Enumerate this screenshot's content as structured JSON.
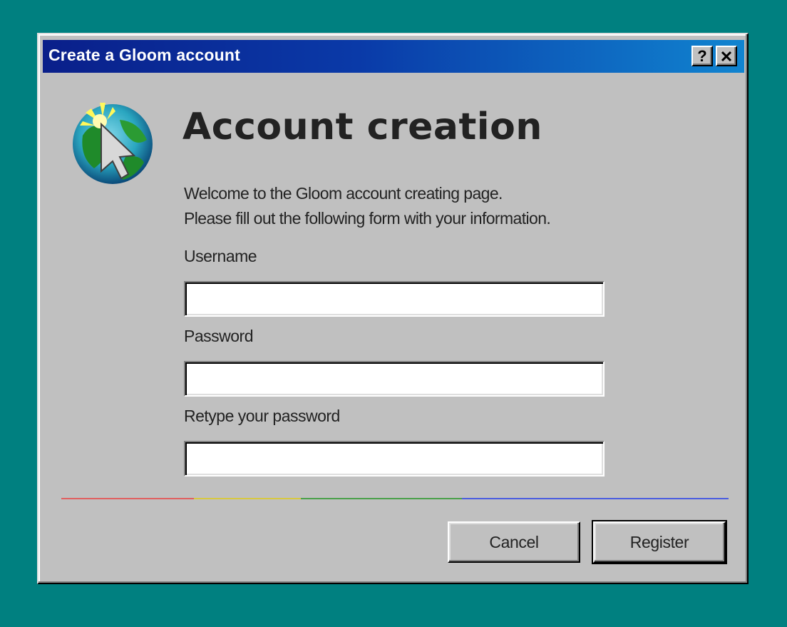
{
  "window": {
    "title": "Create a Gloom account",
    "help_label": "?",
    "close_label": "×"
  },
  "content": {
    "heading": "Account creation",
    "intro_line1": "Welcome to the Gloom account creating page.",
    "intro_line2": "Please fill out the following form with your information."
  },
  "form": {
    "username_label": "Username",
    "username_value": "",
    "password_label": "Password",
    "password_value": "",
    "retype_label": "Retype your password",
    "retype_value": ""
  },
  "buttons": {
    "cancel": "Cancel",
    "register": "Register"
  },
  "colors": {
    "desktop": "#008080",
    "divider": [
      "#e06060",
      "#d8c840",
      "#4aa04a",
      "#4a5ce0"
    ]
  },
  "icons": {
    "logo": "globe-cursor-icon"
  }
}
